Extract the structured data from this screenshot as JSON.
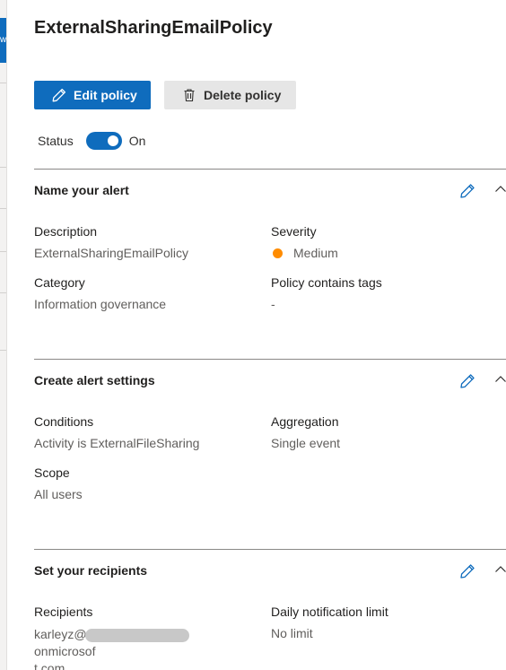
{
  "left_strip": {
    "tab_char": "w"
  },
  "title": "ExternalSharingEmailPolicy",
  "toolbar": {
    "edit_label": "Edit policy",
    "delete_label": "Delete policy"
  },
  "status": {
    "label": "Status",
    "value": "On",
    "enabled": true
  },
  "sections": [
    {
      "title": "Name your alert",
      "fields": [
        {
          "label": "Description",
          "value": "ExternalSharingEmailPolicy"
        },
        {
          "label": "Severity",
          "value": "Medium",
          "severity_color": "#ff8c00"
        },
        {
          "label": "Category",
          "value": "Information governance"
        },
        {
          "label": "Policy contains tags",
          "value": "-"
        }
      ]
    },
    {
      "title": "Create alert settings",
      "fields": [
        {
          "label": "Conditions",
          "value": "Activity is ExternalFileSharing"
        },
        {
          "label": "Aggregation",
          "value": "Single event"
        },
        {
          "label": "Scope",
          "value": "All users"
        }
      ]
    },
    {
      "title": "Set your recipients",
      "fields": [
        {
          "label": "Recipients",
          "value_prefix": "karleyz@",
          "value_suffix": "onmicrosof",
          "value_line2": "t.com"
        },
        {
          "label": "Daily notification limit",
          "value": "No limit"
        }
      ]
    }
  ],
  "colors": {
    "accent": "#0f6cbd",
    "severity_medium": "#ff8c00"
  }
}
